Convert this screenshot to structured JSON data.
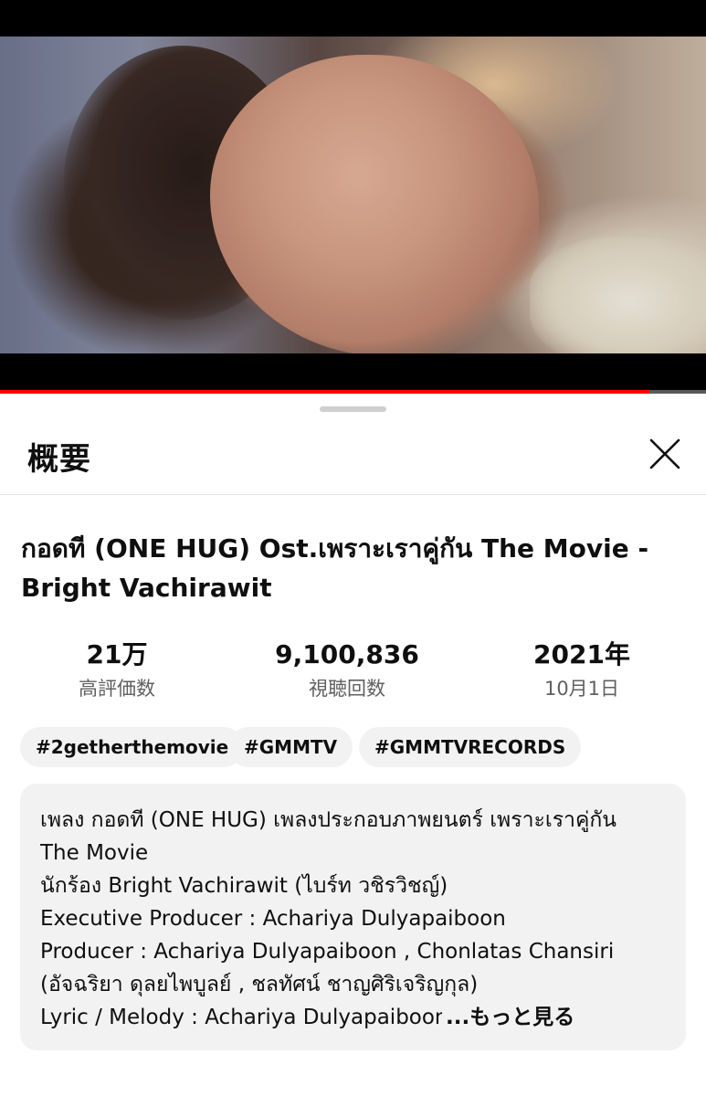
{
  "player": {
    "progress_percent": 92
  },
  "sheet": {
    "title": "概要",
    "close_icon": "close-icon"
  },
  "video": {
    "title": "กอดที (ONE HUG) Ost.เพราะเราคู่กัน The Movie - Bright Vachirawit"
  },
  "stats": [
    {
      "value": "21万",
      "label": "高評価数"
    },
    {
      "value": "9,100,836",
      "label": "視聴回数"
    },
    {
      "value": "2021年",
      "label": "10月1日"
    }
  ],
  "tags": [
    "#2getherthemovie",
    "#GMMTV",
    "#GMMTVRECORDS"
  ],
  "description": {
    "lines": [
      "เพลง กอดที (ONE HUG) เพลงประกอบภาพยนตร์ เพราะเราคู่กัน",
      "The Movie",
      "นักร้อง Bright Vachirawit (ไบร์ท วชิรวิชญ์)",
      "Executive Producer : Achariya Dulyapaiboon",
      "Producer : Achariya Dulyapaiboon , Chonlatas Chansiri",
      "(อัจฉริยา ดุลยไพบูลย์ , ชลทัศน์ ชาญศิริเจริญกุล)",
      "Lyric / Melody : Achariya Dulyapaiboon"
    ],
    "more_label": "...もっと見る"
  },
  "colors": {
    "progress": "#ff0000",
    "chip_bg": "#f2f2f2",
    "secondary_text": "#606060"
  }
}
